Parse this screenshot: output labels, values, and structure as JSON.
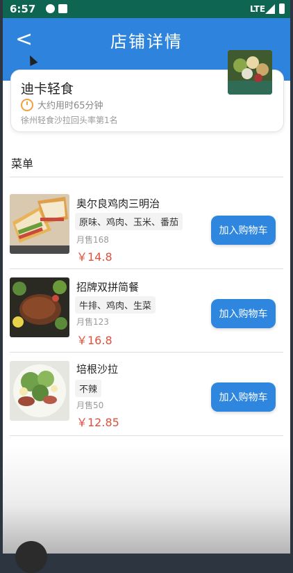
{
  "status_bar": {
    "time": "6:57",
    "network": "LTE"
  },
  "header": {
    "title": "店铺详情",
    "back_glyph": "<"
  },
  "store": {
    "name": "迪卡轻食",
    "delivery_time": "大约用时65分钟",
    "rank_text": "徐州轻食沙拉回头率第1名"
  },
  "menu": {
    "title": "菜单",
    "add_to_cart_label": "加入购物车",
    "items": [
      {
        "name": "奥尔良鸡肉三明治",
        "tags": "原味、鸡肉、玉米、番茄",
        "sold": "月售168",
        "price": "￥14.8"
      },
      {
        "name": "招牌双拼简餐",
        "tags": "牛排、鸡肉、生菜",
        "sold": "月售123",
        "price": "￥16.8"
      },
      {
        "name": "培根沙拉",
        "tags": "不辣",
        "sold": "月售50",
        "price": "￥12.85"
      }
    ]
  },
  "colors": {
    "header": "#2e84dc",
    "price": "#e0503c",
    "button": "#2e86de",
    "status_bar": "#0e6652"
  },
  "icons": [
    "back-arrow-icon",
    "clock-icon",
    "signal-icon",
    "battery-icon"
  ]
}
